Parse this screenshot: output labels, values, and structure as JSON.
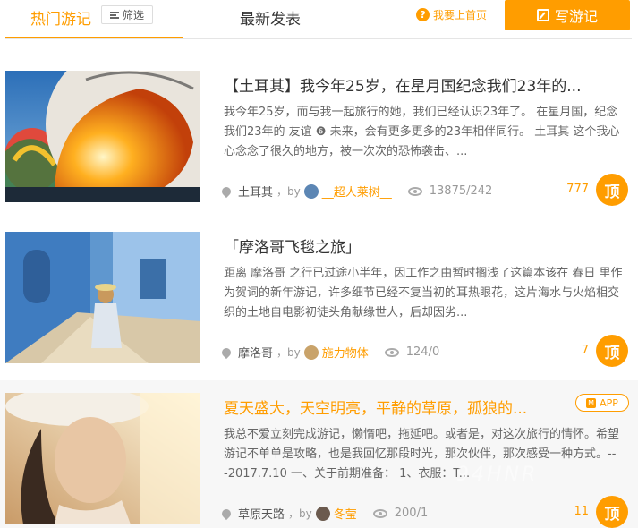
{
  "header": {
    "tab_hot": "热门游记",
    "filter_label": "筛选",
    "tab_latest": "最新发表",
    "help_label": "我要上首页",
    "write_label": "写游记"
  },
  "colors": {
    "accent": "#ff9d00"
  },
  "posts": [
    {
      "title": "【土耳其】我今年25岁，在星月国纪念我们23年的...",
      "desc": "我今年25岁，而与我一起旅行的她，我们已经认识23年了。 在星月国，纪念我们23年的 友谊 ❻ 未来，会有更多更多的23年相伴同行。 土耳其 这个我心心念念了很久的地方，被一次次的恐怖袭击、...",
      "location": "土耳其",
      "by": "，by",
      "author": "__超人莱树__",
      "stats": "13875/242",
      "top_count": "777",
      "top_label": "顶"
    },
    {
      "title": "「摩洛哥飞毯之旅」",
      "desc": "距离 摩洛哥 之行已过途小半年，因工作之由暂时搁浅了这篇本该在 春日 里作为贺词的新年游记，许多细节已经不复当初的耳热眼花，这片海水与火焰相交织的土地自电影初徒头角献缘世人，后却因劣...",
      "location": "摩洛哥",
      "by": "，by",
      "author": "施力物体",
      "stats": "124/0",
      "top_count": "7",
      "top_label": "顶"
    },
    {
      "title": "夏天盛大，天空明亮，平静的草原，孤狼的...",
      "desc": "我总不爱立刻完成游记，懒惰吧，拖延吧。或者是，对这次旅行的情怀。希望游记不单单是攻略，也是我回忆那段时光，那次伙伴，那次感受一种方式。---2017.7.10 一、关于前期准备： 1、衣服：T...",
      "location": "草原天路",
      "by": "，by",
      "author": "冬莹",
      "stats": "200/1",
      "top_count": "11",
      "top_label": "顶",
      "app_label": "APP"
    }
  ],
  "watermark": "94HNR"
}
